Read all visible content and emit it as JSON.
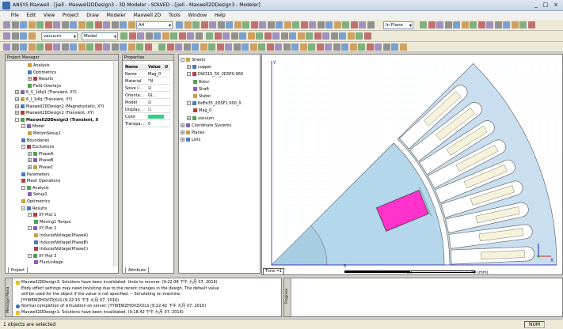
{
  "window": {
    "title": "ANSYS Maxwell - [jiell - Maxwell2DDesign3 - 3D Modeler - SOLVED - [jiell - Maxwell2DDesign3 - Modeler]",
    "controls": [
      "_",
      "□",
      "×"
    ]
  },
  "menu": [
    "File",
    "Edit",
    "View",
    "Project",
    "Draw",
    "Modeler",
    "Maxwell 2D",
    "Tools",
    "Window",
    "Help"
  ],
  "toolbar": {
    "material_combo": "vacuum",
    "model_combo": "Model",
    "zoom_combo": "A4",
    "plane_combo": "In Plane"
  },
  "project_manager": {
    "header": "Project Manager",
    "tab": "Project",
    "items": [
      {
        "label": "Analysis",
        "indent": 3,
        "exp": ""
      },
      {
        "label": "Optimetrics",
        "indent": 3,
        "exp": ""
      },
      {
        "label": "Results",
        "indent": 3,
        "exp": "+"
      },
      {
        "label": "Field Overlays",
        "indent": 3,
        "exp": ""
      },
      {
        "label": "6_V_1dlq1 (Transient, XY)",
        "indent": 1,
        "exp": "+"
      },
      {
        "label": "6_I_1dlq (Transient, XY)",
        "indent": 1,
        "exp": "+"
      },
      {
        "label": "Maxwell2DDesign1 (Magnetostatic, XY)",
        "indent": 1,
        "exp": "+"
      },
      {
        "label": "Maxwell2DDesign2 (Transient, XY)",
        "indent": 1,
        "exp": "+"
      },
      {
        "label": "Maxwell2DDesign3 (Transient, X",
        "indent": 1,
        "exp": "-",
        "bold": true
      },
      {
        "label": "Model",
        "indent": 2,
        "exp": "-"
      },
      {
        "label": "MotionSetup1",
        "indent": 3,
        "exp": ""
      },
      {
        "label": "Boundaries",
        "indent": 2,
        "exp": ""
      },
      {
        "label": "Excitations",
        "indent": 2,
        "exp": "-"
      },
      {
        "label": "PhaseA",
        "indent": 3,
        "exp": "+"
      },
      {
        "label": "PhaseB",
        "indent": 3,
        "exp": "+"
      },
      {
        "label": "PhaseC",
        "indent": 3,
        "exp": "+"
      },
      {
        "label": "Parameters",
        "indent": 2,
        "exp": ""
      },
      {
        "label": "Mesh Operations",
        "indent": 2,
        "exp": ""
      },
      {
        "label": "Analysis",
        "indent": 2,
        "exp": "-"
      },
      {
        "label": "Setup1",
        "indent": 3,
        "exp": ""
      },
      {
        "label": "Optimetrics",
        "indent": 2,
        "exp": ""
      },
      {
        "label": "Results",
        "indent": 2,
        "exp": "-"
      },
      {
        "label": "XY Plot 1",
        "indent": 3,
        "exp": "-"
      },
      {
        "label": "Moving1 Torque",
        "indent": 4,
        "exp": ""
      },
      {
        "label": "XY Plot 2",
        "indent": 3,
        "exp": "-"
      },
      {
        "label": "InducedVoltage(PhaseA)",
        "indent": 4,
        "exp": ""
      },
      {
        "label": "InducedVoltage(PhaseB)",
        "indent": 4,
        "exp": ""
      },
      {
        "label": "InducedVoltage(PhaseC)",
        "indent": 4,
        "exp": ""
      },
      {
        "label": "XY Plot 3",
        "indent": 3,
        "exp": "-"
      },
      {
        "label": "FluxLinkage",
        "indent": 4,
        "exp": ""
      }
    ]
  },
  "properties": {
    "header": "Properties",
    "col_name": "Name",
    "col_value": "Value",
    "col_unit": "U",
    "tab": "Attribute",
    "rows": [
      {
        "k": "Name",
        "v": "Mag_0",
        "u": ""
      },
      {
        "k": "Material",
        "v": "\"N",
        "u": ""
      },
      {
        "k": "Solve I...",
        "v": "☑",
        "u": ""
      },
      {
        "k": "Orienta...",
        "v": "Gl...",
        "u": ""
      },
      {
        "k": "Model",
        "v": "☑",
        "u": ""
      },
      {
        "k": "Display...",
        "v": "☐",
        "u": ""
      },
      {
        "k": "Color",
        "v": "",
        "u": ""
      },
      {
        "k": "Transpa...",
        "v": "0",
        "u": ""
      }
    ]
  },
  "model_tree": {
    "items": [
      {
        "label": "Sheets",
        "indent": 0,
        "exp": "-"
      },
      {
        "label": "copper",
        "indent": 1,
        "exp": "+"
      },
      {
        "label": "DW315_50_2DSF0.960",
        "indent": 1,
        "exp": "-"
      },
      {
        "label": "Rotor",
        "indent": 2,
        "exp": ""
      },
      {
        "label": "Shaft",
        "indent": 2,
        "exp": ""
      },
      {
        "label": "Stator",
        "indent": 2,
        "exp": ""
      },
      {
        "label": "NdFe35_2DSF1.000_X",
        "indent": 1,
        "exp": "-"
      },
      {
        "label": "Mag_0",
        "indent": 2,
        "exp": ""
      },
      {
        "label": "vacuum",
        "indent": 1,
        "exp": "+"
      },
      {
        "label": "Coordinate Systems",
        "indent": 0,
        "exp": "+"
      },
      {
        "label": "Planes",
        "indent": 0,
        "exp": "+"
      },
      {
        "label": "Lists",
        "indent": 0,
        "exp": "+"
      }
    ]
  },
  "viewport": {
    "axis_y": "Y",
    "axis_x": "X",
    "time_label": "Time =1",
    "scale": {
      "left": "0",
      "mid": "20",
      "right": "40 (mm)"
    },
    "colors": {
      "background": "#ffffff",
      "stator": "#c9dff0",
      "rotor": "#b4d7ec",
      "magnet": "#ff33cc",
      "slot": "#f7f3da"
    }
  },
  "messages": {
    "side_label": "Message Mana",
    "lines": [
      "Maxwell2DDesign3: Solutions have been invalidated. Undo to recover.  (9:22:08 下午  九月 07, 2016)",
      "Eddy effect settings may need revisiting due to the recent changes in the design.  The default value",
      "will be used for the object if the value is not specified.  -- Simulating on machine:",
      "JYYWEWZHOVZXXLS  (9:22:15 下午  九月 07, 2016)",
      "Normal completion of simulation on server: JYYWEWZHOVZXXLS  (9:22:42 下午  九月 07, 2016)",
      "Maxwell2DDesign1: Solutions have been invalidated.  (9:18:42 下午  九月 07, 2016)"
    ],
    "progress_label": "Progress"
  },
  "status": {
    "text": "1 objects are selected",
    "num": "NUM"
  }
}
